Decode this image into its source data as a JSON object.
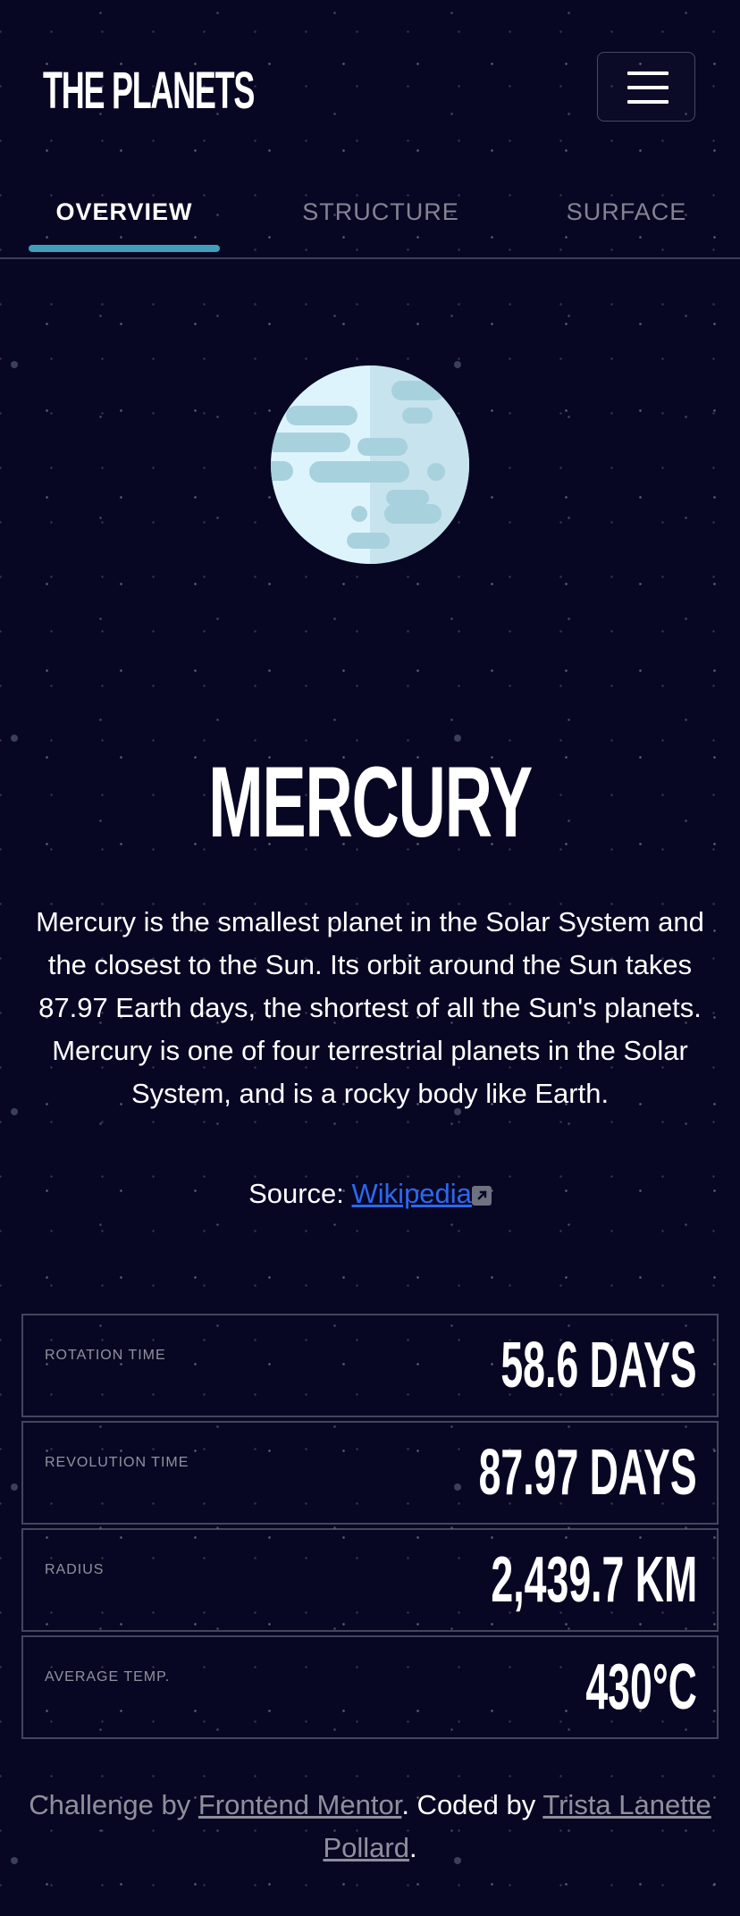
{
  "header": {
    "logo": "THE PLANETS",
    "menu_icon": "hamburger-icon"
  },
  "tabs": [
    {
      "label": "OVERVIEW",
      "active": true
    },
    {
      "label": "STRUCTURE",
      "active": false
    },
    {
      "label": "SURFACE",
      "active": false
    }
  ],
  "planet": {
    "name": "MERCURY",
    "image": "mercury-planet-illustration",
    "description": "Mercury is the smallest planet in the Solar System and the closest to the Sun. Its orbit around the Sun takes 87.97 Earth days, the shortest of all the Sun's planets. Mercury is one of four terrestrial planets in the Solar System, and is a rocky body like Earth.",
    "source_label": "Source:",
    "source_link": "Wikipedia",
    "source_icon": "external-link-icon"
  },
  "stats": [
    {
      "label": "ROTATION TIME",
      "value": "58.6 DAYS"
    },
    {
      "label": "REVOLUTION TIME",
      "value": "87.97 DAYS"
    },
    {
      "label": "RADIUS",
      "value": "2,439.7 KM"
    },
    {
      "label": "AVERAGE TEMP.",
      "value": "430°C"
    }
  ],
  "footer": {
    "challenge_by": "Challenge by",
    "challenge_link": "Frontend Mentor",
    "coded_by": ". Coded by",
    "author_link": "Trista Lanette Pollard",
    "end": "."
  },
  "colors": {
    "background": "#070724",
    "accent": "#419EBB",
    "link": "#2D68F0"
  }
}
